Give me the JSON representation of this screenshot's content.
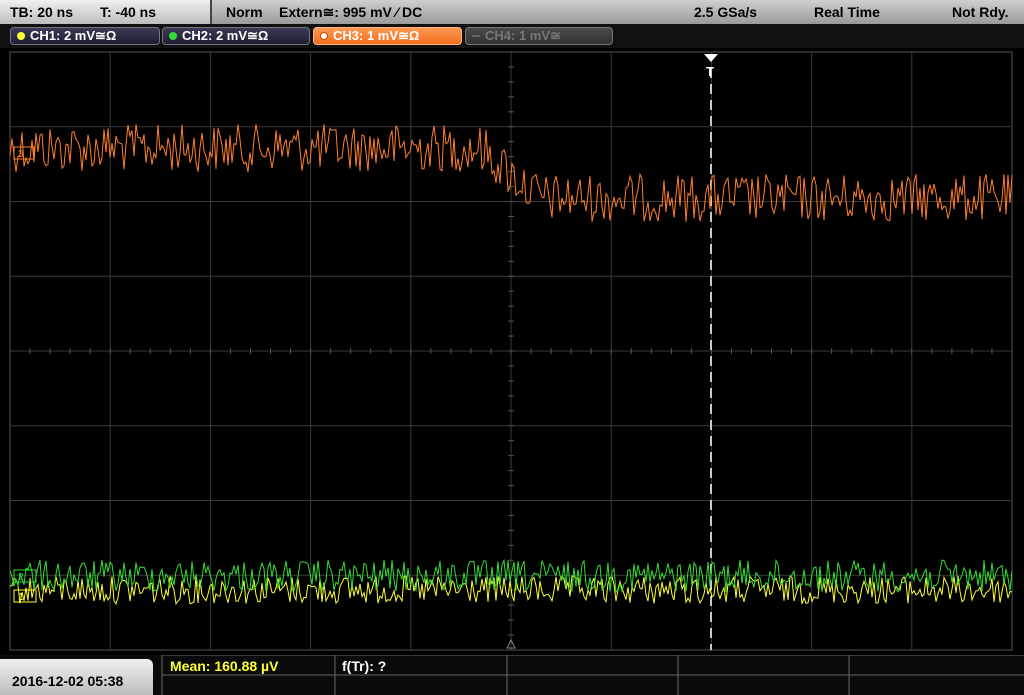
{
  "topbar": {
    "timebase": "TB: 20 ns",
    "trigger_pos": "T: -40 ns",
    "mode": "Norm",
    "trigger_source": "Extern≅: 995 mV ⁄ DC",
    "sample_rate": "2.5 GSa/s",
    "acq_mode": "Real Time",
    "status": "Not Rdy."
  },
  "channels": [
    {
      "label": "CH1: 2 mV≅Ω",
      "color": "#ffff33"
    },
    {
      "label": "CH2: 2 mV≅Ω",
      "color": "#33dd33"
    },
    {
      "label": "CH3: 1 mV≅Ω",
      "color": "#ff7f2a"
    },
    {
      "label": "CH4: 1 mV≅",
      "color": "#888888"
    }
  ],
  "markers": {
    "trigger": "T",
    "ch1": "1",
    "ch2": "2",
    "ch3": "3"
  },
  "bottom": {
    "datetime": "2016-12-02 05:38",
    "mean_label": "Mean: 160.88 µV",
    "freq_label": "f(Tr): ?"
  }
}
